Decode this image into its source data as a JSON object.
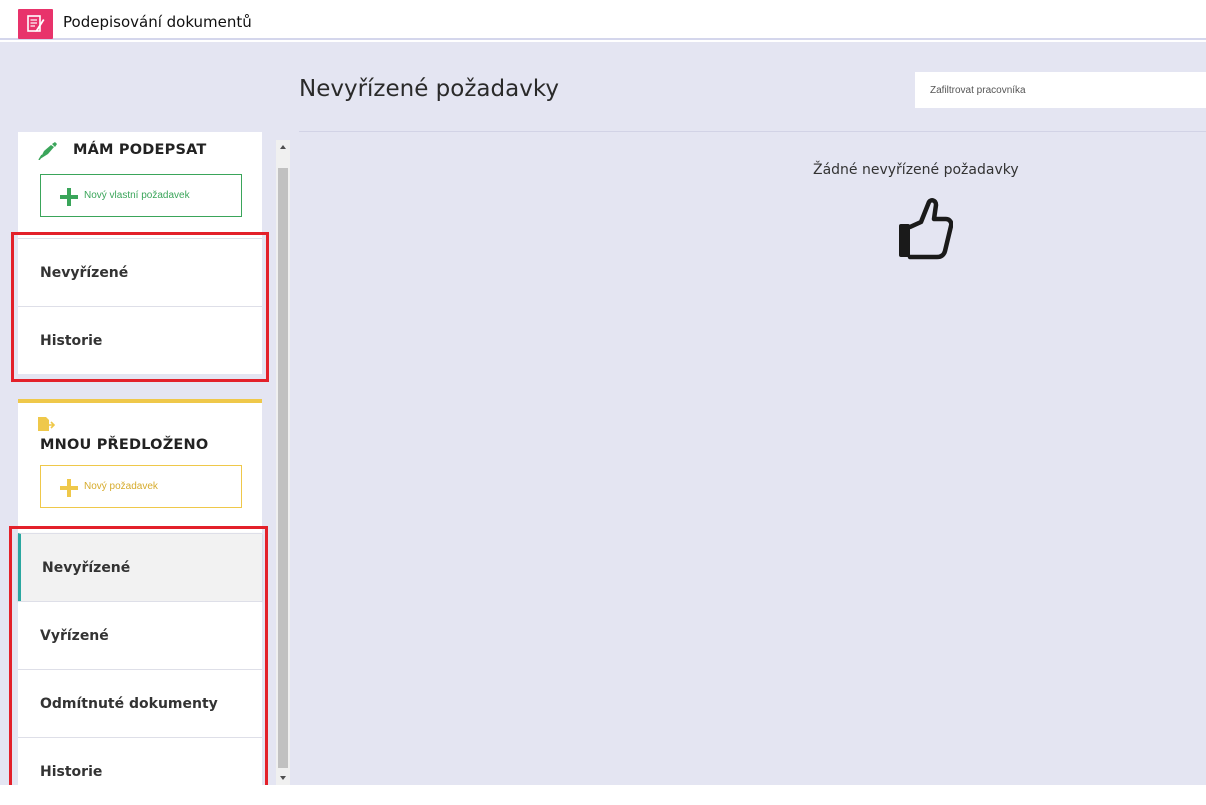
{
  "app": {
    "title": "Podepisování dokumentů",
    "icon": "signature-document-icon",
    "accent": "#e8336b"
  },
  "main": {
    "title": "Nevyřízené požadavky",
    "filter_placeholder": "Zafiltrovat pracovníka",
    "empty_message": "Žádné nevyřízené požadavky",
    "empty_icon": "thumbs-up-icon"
  },
  "sign_section": {
    "heading": "MÁM PODEPSAT",
    "icon": "pen-icon",
    "color": "#3aa55a",
    "new_button": "Nový vlastní požadavek",
    "items": [
      {
        "label": "Nevyřízené"
      },
      {
        "label": "Historie"
      }
    ]
  },
  "submitted_section": {
    "heading": "MNOU PŘEDLOŽENO",
    "icon": "document-send-icon",
    "color": "#efc84a",
    "new_button": "Nový požadavek",
    "items": [
      {
        "label": "Nevyřízené",
        "active": true
      },
      {
        "label": "Vyřízené"
      },
      {
        "label": "Odmítnuté dokumenty"
      },
      {
        "label": "Historie"
      }
    ]
  }
}
